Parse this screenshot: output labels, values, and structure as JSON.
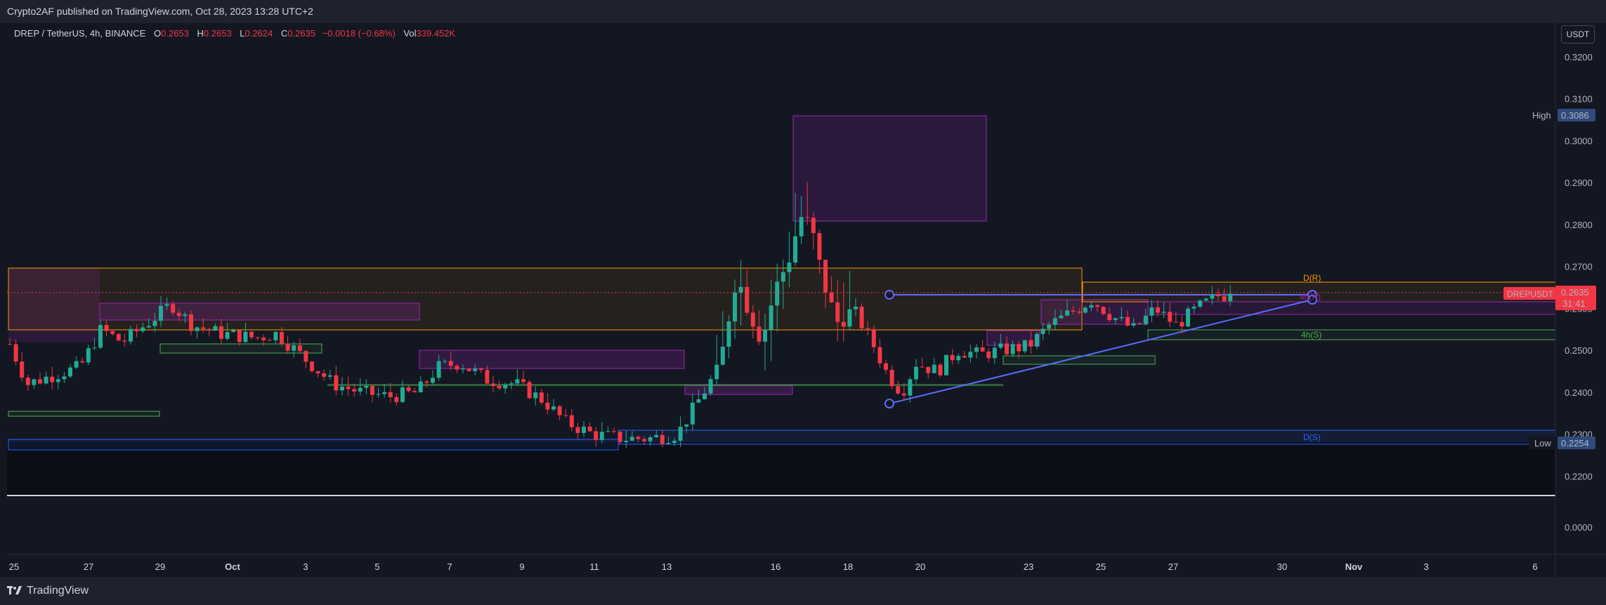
{
  "header": {
    "published": "Crypto2AF published on TradingView.com, Oct 28, 2023 13:28 UTC+2"
  },
  "legend": {
    "symbol": "DREP / TetherUS, 4h, BINANCE",
    "o_label": "O",
    "o_value": "0.2653",
    "h_label": "H",
    "h_value": "0.2653",
    "l_label": "L",
    "l_value": "0.2624",
    "c_label": "C",
    "c_value": "0.2635",
    "change": "−0.0018 (−0.68%)",
    "vol_label": "Vol",
    "vol_value": "339.452K"
  },
  "currency_button": "USDT",
  "markers": {
    "high_label": "High",
    "high_value": "0.3086",
    "low_label": "Low",
    "low_value": "0.2254",
    "symbol_tag": "DREPUSDT",
    "last_value": "0.2635",
    "countdown": "31:41"
  },
  "zone_labels": {
    "dr": "D(R)",
    "r4h": "4h(R)",
    "s4h": "4h(S)",
    "ds": "D(S)"
  },
  "footer": {
    "brand": "TradingView"
  },
  "colors": {
    "up": "#22ab94",
    "down": "#f23645",
    "background": "#131722",
    "purple": "#9c27b0",
    "orange": "#ff9800",
    "green": "#4caf50",
    "blue": "#2962ff"
  },
  "chart_data": {
    "type": "candlestick",
    "symbol": "DREP / TetherUS",
    "interval": "4h",
    "exchange": "BINANCE",
    "y_axis": {
      "ticks": [
        "0.3200",
        "0.3100",
        "0.3000",
        "0.2900",
        "0.2800",
        "0.2700",
        "0.2600",
        "0.2500",
        "0.2400",
        "0.2300",
        "0.2200"
      ],
      "range": [
        0.2154,
        0.328
      ]
    },
    "volume_pane": {
      "ticks": [
        "0.0000"
      ]
    },
    "x_axis": {
      "ticks": [
        "25",
        "27",
        "29",
        "Oct",
        "3",
        "5",
        "7",
        "9",
        "11",
        "13",
        "16",
        "18",
        "20",
        "23",
        "25",
        "27",
        "30",
        "Nov",
        "3",
        "6"
      ]
    },
    "price_path": [
      [
        0,
        0.2515
      ],
      [
        25,
        0.242
      ],
      [
        60,
        0.244
      ],
      [
        100,
        0.246
      ],
      [
        130,
        0.255
      ],
      [
        160,
        0.252
      ],
      [
        200,
        0.257
      ],
      [
        230,
        0.261
      ],
      [
        260,
        0.256
      ],
      [
        300,
        0.254
      ],
      [
        350,
        0.253
      ],
      [
        380,
        0.254
      ],
      [
        420,
        0.248
      ],
      [
        460,
        0.242
      ],
      [
        500,
        0.24
      ],
      [
        540,
        0.239
      ],
      [
        580,
        0.24
      ],
      [
        610,
        0.246
      ],
      [
        640,
        0.247
      ],
      [
        680,
        0.243
      ],
      [
        720,
        0.242
      ],
      [
        760,
        0.238
      ],
      [
        790,
        0.233
      ],
      [
        830,
        0.23
      ],
      [
        870,
        0.229
      ],
      [
        910,
        0.229
      ],
      [
        950,
        0.23
      ],
      [
        980,
        0.238
      ],
      [
        1010,
        0.246
      ],
      [
        1035,
        0.268
      ],
      [
        1050,
        0.26
      ],
      [
        1070,
        0.252
      ],
      [
        1090,
        0.265
      ],
      [
        1110,
        0.272
      ],
      [
        1125,
        0.282
      ],
      [
        1140,
        0.28
      ],
      [
        1160,
        0.265
      ],
      [
        1180,
        0.256
      ],
      [
        1200,
        0.26
      ],
      [
        1230,
        0.251
      ],
      [
        1250,
        0.244
      ],
      [
        1270,
        0.24
      ],
      [
        1290,
        0.247
      ],
      [
        1320,
        0.245
      ],
      [
        1350,
        0.25
      ],
      [
        1380,
        0.249
      ],
      [
        1410,
        0.25
      ],
      [
        1450,
        0.251
      ],
      [
        1480,
        0.256
      ],
      [
        1510,
        0.259
      ],
      [
        1540,
        0.262
      ],
      [
        1570,
        0.258
      ],
      [
        1600,
        0.255
      ],
      [
        1630,
        0.26
      ],
      [
        1660,
        0.256
      ],
      [
        1690,
        0.26
      ],
      [
        1720,
        0.263
      ],
      [
        1745,
        0.2635
      ]
    ]
  }
}
